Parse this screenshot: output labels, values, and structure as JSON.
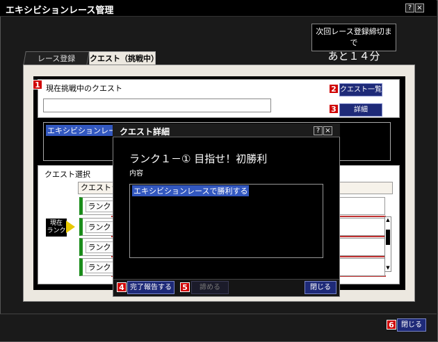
{
  "window": {
    "title": "エキシビションレース管理",
    "help_label": "?",
    "close_label": "×"
  },
  "deadline": {
    "label": "次回レース登録締切まで",
    "value": "あと１４分"
  },
  "tabs": [
    {
      "label": "レース登録",
      "active": false
    },
    {
      "label": "クエスト（挑戦中）",
      "active": true
    }
  ],
  "quest": {
    "current_label": "現在挑戦中のクエスト",
    "current_value": "",
    "list_button": "クエスト一覧",
    "detail_button": "詳細",
    "info_text": "エキシビションレー"
  },
  "selection": {
    "label": "クエスト選択",
    "header": "クエストラ",
    "rows": [
      {
        "rank": "ランク"
      },
      {
        "rank": "ランク"
      },
      {
        "rank": "ランク"
      },
      {
        "rank": "ランク"
      }
    ],
    "current_rank_label": "現在\nランク",
    "current_rank_line1": "現在",
    "current_rank_line2": "ランク"
  },
  "badges": [
    "1",
    "2",
    "3",
    "4",
    "5",
    "6"
  ],
  "modal": {
    "title": "クエスト詳細",
    "help_label": "?",
    "close_label": "×",
    "heading": "ランク１－① 目指せ！初勝利",
    "content_label": "内容",
    "content_text": "エキシビションレースで勝利する",
    "report_button": "完了報告する",
    "give_up_button": "諦める",
    "close_button": "閉じる"
  },
  "footer": {
    "close_button": "閉じる"
  },
  "colors": {
    "badge": "#d00000",
    "button": "#1e2a78",
    "selection": "#3358c0",
    "current_rank_arrow": "#e8c800",
    "rank_stripe": "#1a8c1a"
  }
}
